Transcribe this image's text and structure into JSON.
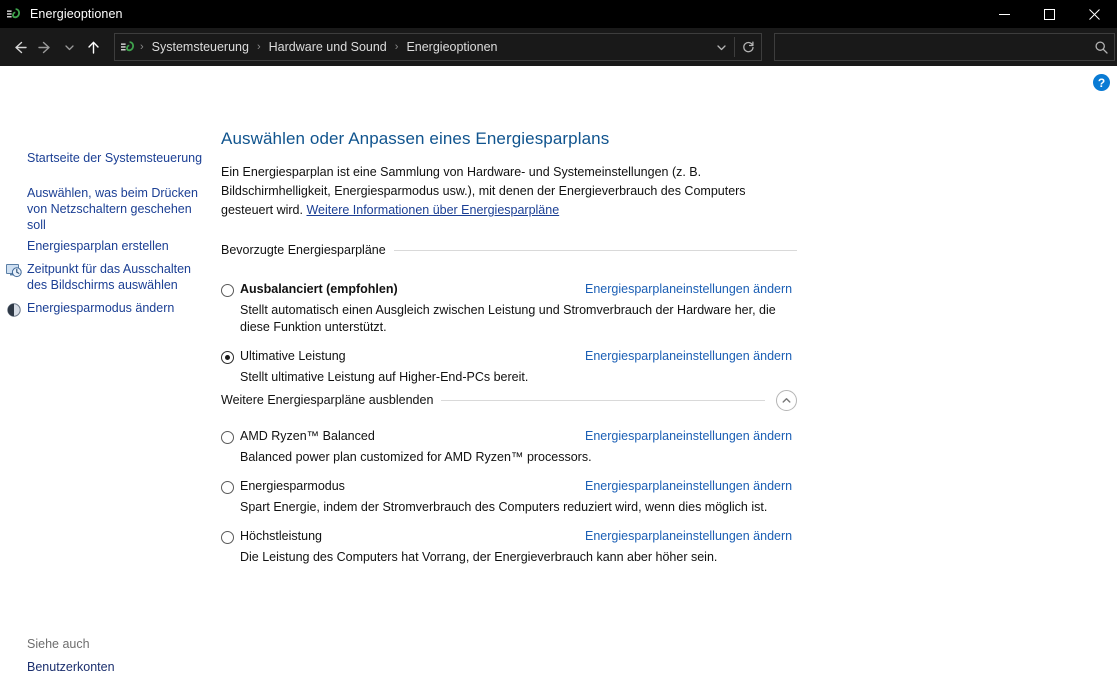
{
  "window": {
    "title": "Energieoptionen",
    "icon": "power-plug-icon",
    "minimize_label": "─",
    "maximize_label": "□",
    "close_label": "✕"
  },
  "nav": {
    "back_label": "←",
    "forward_label": "→",
    "recent_label": "∨",
    "up_label": "↑",
    "breadcrumb": [
      "Systemsteuerung",
      "Hardware und Sound",
      "Energieoptionen"
    ],
    "separator": "›",
    "dropdown_label": "∨",
    "refresh_label": "⟳"
  },
  "search": {
    "value": "",
    "placeholder": "",
    "icon": "search-icon"
  },
  "help": {
    "label": "?"
  },
  "sidebar": {
    "home_link": "Startseite der Systemsteuerung",
    "items": [
      {
        "label": "Auswählen, was beim Drücken von Netzschaltern geschehen soll",
        "icon": null
      },
      {
        "label": "Energiesparplan erstellen",
        "icon": null
      },
      {
        "label": "Zeitpunkt für das Ausschalten des Bildschirms auswählen",
        "icon": "monitor-clock-icon"
      },
      {
        "label": "Energiesparmodus ändern",
        "icon": "sleep-moon-icon"
      }
    ],
    "see_also_label": "Siehe auch",
    "see_also_link": "Benutzerkonten"
  },
  "main": {
    "title": "Auswählen oder Anpassen eines Energiesparplans",
    "description_part1": "Ein Energiesparplan ist eine Sammlung von Hardware- und Systemeinstellungen (z. B. Bildschirmhelligkeit, Energiesparmodus usw.), mit denen der Energieverbrauch des Computers gesteuert wird. ",
    "description_link": "Weitere Informationen über Energiesparpläne",
    "settings_link_label": "Energiesparplaneinstellungen ändern",
    "preferred_section": {
      "heading": "Bevorzugte Energiesparpläne",
      "plans": [
        {
          "name": "Ausbalanciert (empfohlen)",
          "bold": true,
          "selected": false,
          "description": "Stellt automatisch einen Ausgleich zwischen Leistung und Stromverbrauch der Hardware her, die diese Funktion unterstützt."
        },
        {
          "name": "Ultimative Leistung",
          "bold": false,
          "selected": true,
          "description": "Stellt ultimative Leistung auf Higher-End-PCs bereit."
        }
      ]
    },
    "additional_section": {
      "heading": "Weitere Energiesparpläne ausblenden",
      "collapse_icon": "chevron-up-icon",
      "plans": [
        {
          "name": "AMD Ryzen™ Balanced",
          "bold": false,
          "selected": false,
          "description": "Balanced power plan customized for AMD Ryzen™ processors."
        },
        {
          "name": "Energiesparmodus",
          "bold": false,
          "selected": false,
          "description": "Spart Energie, indem der Stromverbrauch des Computers reduziert wird, wenn dies möglich ist."
        },
        {
          "name": "Höchstleistung",
          "bold": false,
          "selected": false,
          "description": "Die Leistung des Computers hat Vorrang, der Energieverbrauch kann aber höher sein."
        }
      ]
    }
  },
  "colors": {
    "titlebar_bg": "#000000",
    "navbar_bg": "#191919",
    "content_bg": "#ffffff",
    "heading_blue": "#10548e",
    "link_blue": "#1b3f94",
    "plan_link_blue": "#1b5fb5",
    "help_blue": "#0a7bd4"
  }
}
